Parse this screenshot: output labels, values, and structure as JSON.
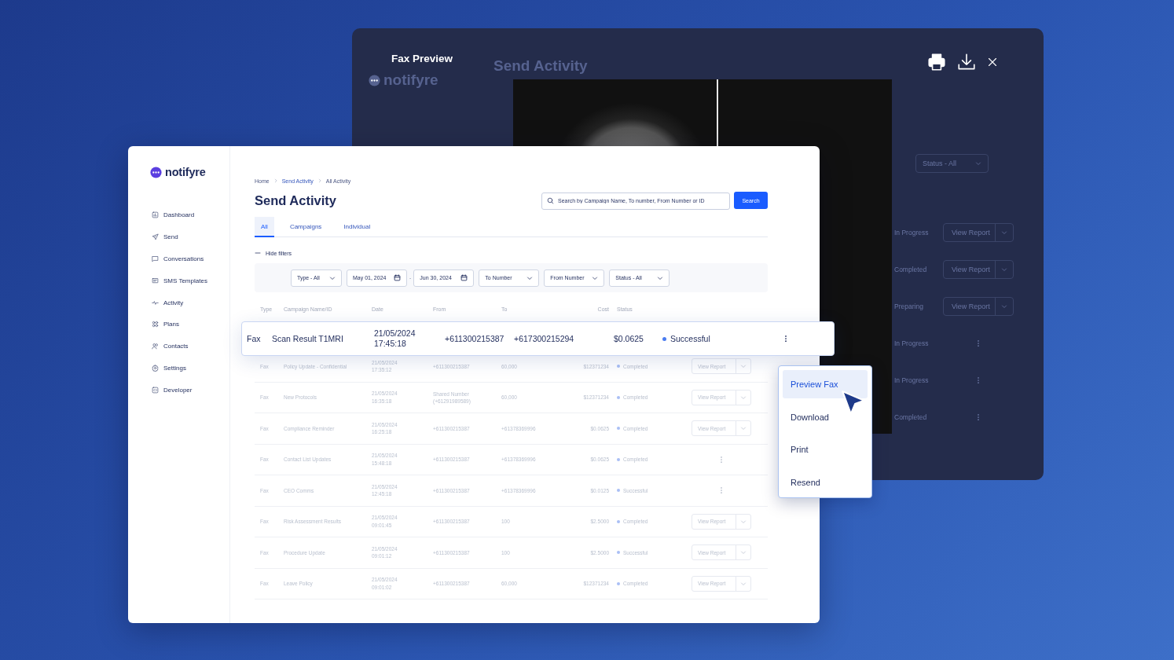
{
  "background_window": {
    "title": "Fax Preview",
    "logo": "notifyre",
    "heading": "Send Activity",
    "status_filter": "Status - All",
    "rows": [
      {
        "status": "In Progress",
        "action": {
          "kind": "split",
          "label": "View Report"
        }
      },
      {
        "status": "Completed",
        "action": {
          "kind": "split",
          "label": "View Report"
        }
      },
      {
        "status": "Preparing",
        "action": {
          "kind": "split",
          "label": "View Report"
        }
      },
      {
        "status": "In Progress",
        "action": {
          "kind": "menu"
        }
      },
      {
        "status": "In Progress",
        "action": {
          "kind": "menu"
        }
      },
      {
        "status": "Completed",
        "action": {
          "kind": "menu"
        }
      }
    ]
  },
  "app": {
    "logo": "notifyre",
    "sidebar": {
      "items": [
        {
          "label": "Dashboard",
          "selected": false
        },
        {
          "label": "Send",
          "selected": false
        },
        {
          "label": "Conversations",
          "selected": false
        },
        {
          "label": "SMS Templates",
          "selected": false
        },
        {
          "label": "Activity",
          "selected": false
        },
        {
          "label": "Plans",
          "selected": false
        },
        {
          "label": "Contacts",
          "selected": false
        },
        {
          "label": "Settings",
          "selected": false
        },
        {
          "label": "Developer",
          "selected": false
        }
      ]
    },
    "breadcrumb": [
      "Home",
      "Send Activity",
      "All Activity"
    ],
    "title": "Send Activity",
    "search": {
      "placeholder": "Search by Campaign Name, To number, From Number or ID",
      "button": "Search"
    },
    "tabs": [
      {
        "label": "All",
        "selected": true
      },
      {
        "label": "Campaigns",
        "selected": false
      },
      {
        "label": "Individual",
        "selected": false
      }
    ],
    "filters_toggle": "Hide filters",
    "filters": [
      {
        "kind": "select",
        "label": "Type - All"
      },
      {
        "kind": "date",
        "label": "May 01, 2024"
      },
      {
        "kind": "separator",
        "label": "-"
      },
      {
        "kind": "date",
        "label": "Jun 30, 2024"
      },
      {
        "kind": "select",
        "label": "To Number"
      },
      {
        "kind": "select",
        "label": "From Number"
      },
      {
        "kind": "select",
        "label": "Status - All"
      }
    ],
    "table": {
      "columns": [
        "Type",
        "Campaign Name/ID",
        "Date",
        "From",
        "To",
        "Cost",
        "Status"
      ],
      "focused_row": {
        "type": "Fax",
        "name": "Scan Result T1MRI",
        "date": "21/05/2024",
        "time": "17:45:18",
        "from": "+611300215387",
        "to": "+617300215294",
        "cost": "$0.0625",
        "status": "Successful",
        "action": {
          "kind": "menu"
        }
      },
      "rows": [
        {
          "type": "Fax",
          "name": "Policy Update - Confidential",
          "date": "21/05/2024",
          "time": "17:35:12",
          "from": "+611300215387",
          "to": "60,000",
          "cost": "$12371234",
          "status": "Completed",
          "action": {
            "kind": "split",
            "label": "View Report"
          }
        },
        {
          "type": "Fax",
          "name": "New Protocols",
          "date": "21/05/2024",
          "time": "16:35:18",
          "from": "Shared Number (+61291989589)",
          "to": "60,000",
          "cost": "$12371234",
          "status": "Completed",
          "action": {
            "kind": "split",
            "label": "View Report"
          }
        },
        {
          "type": "Fax",
          "name": "Compliance Reminder",
          "date": "21/05/2024",
          "time": "16:25:18",
          "from": "+611300215387",
          "to": "+61378369996",
          "cost": "$0.0625",
          "status": "Completed",
          "action": {
            "kind": "split",
            "label": "View Report"
          }
        },
        {
          "type": "Fax",
          "name": "Contact List Updates",
          "date": "21/05/2024",
          "time": "15:48:18",
          "from": "+611300215387",
          "to": "+61378369996",
          "cost": "$0.0625",
          "status": "Completed",
          "action": {
            "kind": "menu"
          }
        },
        {
          "type": "Fax",
          "name": "CEO Comms",
          "date": "21/05/2024",
          "time": "12:45:18",
          "from": "+611300215387",
          "to": "+61378369996",
          "cost": "$0.0125",
          "status": "Successful",
          "action": {
            "kind": "menu"
          }
        },
        {
          "type": "Fax",
          "name": "Risk Assessment Results",
          "date": "21/05/2024",
          "time": "09:01:45",
          "from": "+611300215387",
          "to": "100",
          "cost": "$2.5000",
          "status": "Completed",
          "action": {
            "kind": "split",
            "label": "View Report"
          }
        },
        {
          "type": "Fax",
          "name": "Procedure Update",
          "date": "21/05/2024",
          "time": "09:01:12",
          "from": "+611300215387",
          "to": "100",
          "cost": "$2.5000",
          "status": "Successful",
          "action": {
            "kind": "split",
            "label": "View Report"
          }
        },
        {
          "type": "Fax",
          "name": "Leave Policy",
          "date": "21/05/2024",
          "time": "09:01:02",
          "from": "+611300215387",
          "to": "60,000",
          "cost": "$12371234",
          "status": "Completed",
          "action": {
            "kind": "split",
            "label": "View Report"
          }
        }
      ]
    }
  },
  "context_menu": {
    "items": [
      {
        "label": "Preview Fax",
        "selected": true
      },
      {
        "label": "Download",
        "selected": false
      },
      {
        "label": "Print",
        "selected": false
      },
      {
        "label": "Resend",
        "selected": false
      }
    ]
  }
}
